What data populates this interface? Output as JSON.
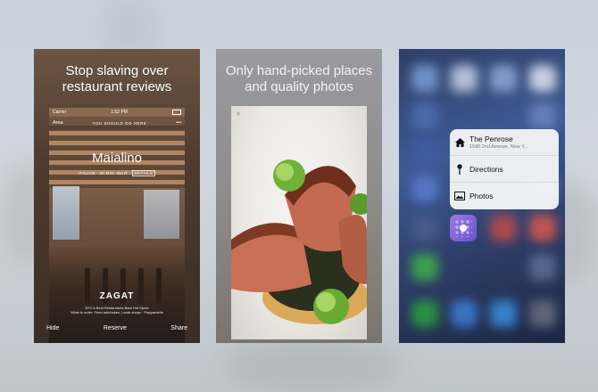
{
  "panel1": {
    "headline_line1": "Stop slaving over",
    "headline_line2": "restaurant reviews",
    "status_carrier": "Carrier",
    "status_time": "1:52 PM",
    "nav_left": "Area",
    "nav_title": "YOU SHOULD GO HERE",
    "nav_more": "•••",
    "restaurant_name": "Maialino",
    "meta": "ITALIAN · 20 MIN. WAIT",
    "meta_badge": "DETAILS",
    "brand": "ZAGAT",
    "brand_sub_1": "NYC's Best Restaurants Bars Hot Spots",
    "brand_sub_2": "What to order: Fried artichokes, Lamb chops · Pappardelle",
    "footer": {
      "hide": "Hide",
      "reserve": "Reserve",
      "share": "Share"
    }
  },
  "panel2": {
    "headline_line1": "Only hand-picked places",
    "headline_line2": "and quality photos",
    "close_glyph": "×"
  },
  "panel3": {
    "menu": [
      {
        "label": "The Penrose",
        "sublabel": "1590 2nd Avenue, New Y...",
        "icon": "home-icon"
      },
      {
        "label": "Directions",
        "icon": "pin-icon"
      },
      {
        "label": "Photos",
        "icon": "photo-icon"
      }
    ]
  }
}
